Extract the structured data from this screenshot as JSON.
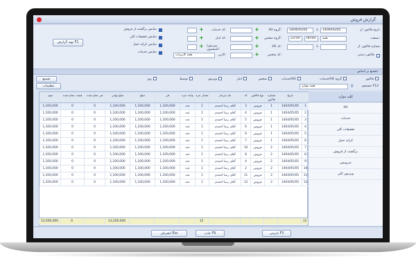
{
  "window": {
    "title": "گزارش فروش"
  },
  "form": {
    "date_from_label": "تاریخ فاکتور: از",
    "date_from": "1404/05/05",
    "date_to_label": "تا",
    "date_to": "1404/05/05",
    "shift_label": "شیفت:",
    "shift_value": "همه",
    "time_from": "00:00",
    "time_to": "23:59",
    "invoice_no_label": "شماره فاکتور: از",
    "invoice_to_label": "تا",
    "manual_invoice_label": "فاکتور دستی",
    "goods_group_label": "گروه کالا:",
    "person_group_label": "گروه شخص:",
    "goods_code_label": "کد کالا:",
    "person_code_label": "کد شخص:",
    "service_code_label": "کد خدمات:",
    "delivery_code_label": "کد انبار:",
    "visitor_label": "ویزیتور/کمیسیون:",
    "user_label": "کاربر:",
    "user_value": "همه کاربرات",
    "opt_return": "نمایش برگشت از فروش",
    "opt_discount": "نمایش تخفیفات کلی",
    "opt_extra_cost": "نمایش کرایه حمل",
    "opt_services": "نمایش خدمات",
    "report_button": "تهیه گزارش F2"
  },
  "band": {
    "label": "تجمیع بر اساس:"
  },
  "filters": {
    "items": [
      "فاکتور",
      "گروه کالا/خدمات",
      "کالا/خدمات",
      "شخص",
      "انبار",
      "ویزیتور",
      "توسط",
      "روز"
    ],
    "group_button": "تجمیع"
  },
  "search": {
    "label": "جستجو F12",
    "value": "همه موارد",
    "settings_button": "تنظیمات"
  },
  "left_panel": {
    "header": "کلیه موارد",
    "items": [
      "کالا",
      "خدمات",
      "تخفیفات کلی",
      "کرایه حمل",
      "برگشت از فروش",
      "سرویس",
      "ویزیتور کلی"
    ]
  },
  "table": {
    "columns": [
      "",
      "تاریخ",
      "شماره فاکتور",
      "نوع فاکتور",
      "کد",
      "نام خریدار",
      "مقدار جزء",
      "واحد جزء",
      "فی",
      "مبلغ",
      "مبلغ نهایی",
      "فی تمام شده",
      "قیمت تمام شده",
      "سود"
    ],
    "rows": [
      [
        "1",
        "1404/05/05",
        "1",
        "فروش",
        "3",
        "آقای رضا احمدی",
        "1",
        "عدد",
        "1,100,000",
        "1,100,000",
        "1,100,000",
        "0",
        "0",
        "1,100,000"
      ],
      [
        "2",
        "1404/05/05",
        "1",
        "فروش",
        "4",
        "آقای رضا احمدی",
        "1",
        "عدد",
        "1,100,000",
        "1,100,000",
        "1,100,000",
        "0",
        "0",
        "1,100,000"
      ],
      [
        "3",
        "1404/05/05",
        "1",
        "فروش",
        "5",
        "آقای رضا احمدی",
        "1",
        "عدد",
        "1,100,000",
        "1,100,000",
        "1,100,000",
        "0",
        "0",
        "1,100,000"
      ],
      [
        "4",
        "1404/05/05",
        "1",
        "فروش",
        "6",
        "آقای رضا احمدی",
        "1",
        "عدد",
        "1,100,000",
        "1,100,000",
        "1,100,000",
        "0",
        "0",
        "1,100,000"
      ],
      [
        "5",
        "1404/05/05",
        "1",
        "فروش",
        "9",
        "آقای رضا احمدی",
        "1",
        "عدد",
        "1,100,000",
        "1,100,000",
        "1,100,000",
        "0",
        "0",
        "1,100,000"
      ],
      [
        "6",
        "1404/05/05",
        "1",
        "فروش",
        "7",
        "آقای رضا احمدی",
        "1",
        "عدد",
        "1,100,000",
        "1,100,000",
        "1,100,000",
        "0",
        "0",
        "1,100,000"
      ],
      [
        "7",
        "1404/05/05",
        "2",
        "فروش",
        "10",
        "آقای رضا احمدی",
        "1",
        "عدد",
        "1,100,000",
        "1,100,000",
        "1,100,000",
        "0",
        "0",
        "1,100,000"
      ],
      [
        "8",
        "1404/05/05",
        "2",
        "فروش",
        "8",
        "آقای رضا احمدی",
        "1",
        "عدد",
        "1,100,000",
        "1,100,000",
        "1,100,000",
        "0",
        "0",
        "1,100,000"
      ],
      [
        "9",
        "1404/05/05",
        "2",
        "فروش",
        "4",
        "آقای رضا احمدی",
        "1",
        "عدد",
        "1,100,000",
        "1,100,000",
        "1,100,000",
        "0",
        "0",
        "1,100,000"
      ],
      [
        "10",
        "1404/05/05",
        "2",
        "فروش",
        "2",
        "آقای رضا احمدی",
        "1",
        "عدد",
        "1,100,000",
        "1,100,000",
        "1,100,000",
        "0",
        "0",
        "1,100,000"
      ],
      [
        "11",
        "1404/05/05",
        "2",
        "فروش",
        "11",
        "آقای رضا احمدی",
        "1",
        "عدد",
        "1,100,000",
        "1,100,000",
        "1,100,000",
        "0",
        "0",
        "1,100,000"
      ],
      [
        "12",
        "1404/05/05",
        "2",
        "فروش",
        "12",
        "آقای رضا احمدی",
        "1",
        "عدد",
        "1,100,000",
        "1,100,000",
        "1,100,000",
        "0",
        "0",
        "1,100,000"
      ]
    ],
    "totals": [
      "12",
      "",
      "",
      "",
      "",
      "",
      "12",
      "",
      "",
      "",
      "13,200,000",
      "",
      "0",
      "12,000,000"
    ]
  },
  "bottom": {
    "preview": "بازبینی F3",
    "print": "چاپ F9",
    "exit": "انصراف Esc"
  }
}
